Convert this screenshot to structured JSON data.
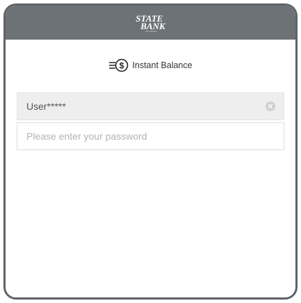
{
  "header": {
    "logo_line1": "STATE",
    "logo_line2": "BANK",
    "logo_sub": "OF TEXAS"
  },
  "instant_balance": {
    "label": "Instant Balance",
    "icon": "dollar-coin-speed-icon"
  },
  "username_field": {
    "value": "User*****",
    "clear_icon": "clear-circle-icon"
  },
  "password_field": {
    "placeholder": "Please enter your password",
    "value": ""
  },
  "colors": {
    "header_bg": "#6d7276",
    "frame_border": "#5e6367",
    "username_bg": "#eeeeee",
    "placeholder": "#b3b3b3"
  }
}
